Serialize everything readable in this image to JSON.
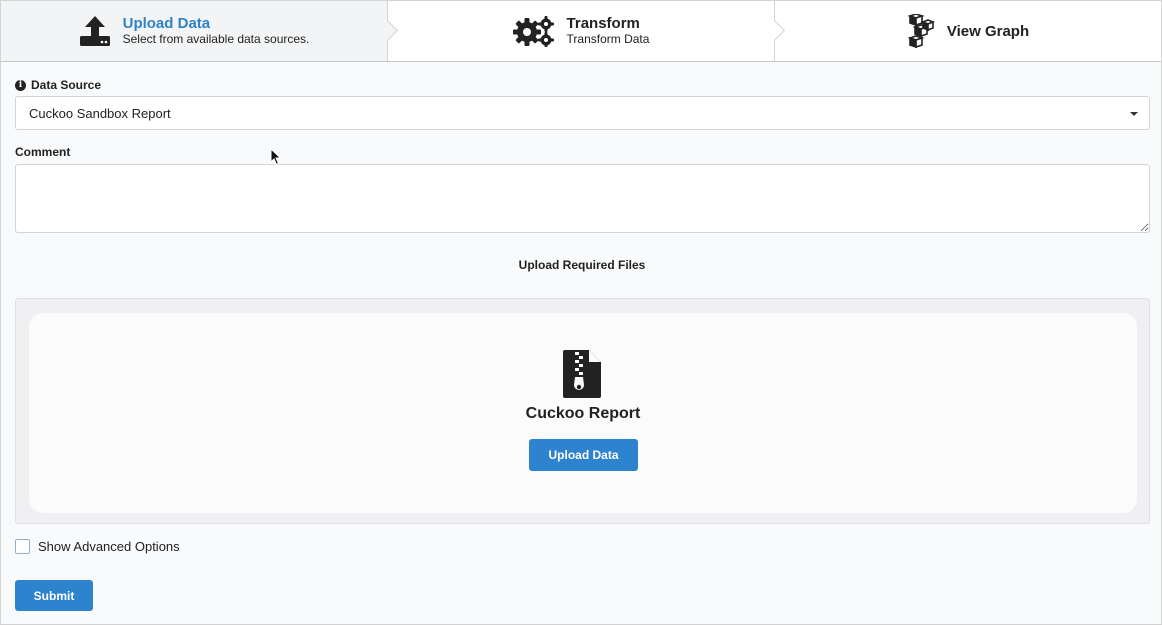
{
  "steps": [
    {
      "title": "Upload Data",
      "description": "Select from available data sources.",
      "icon": "upload-icon",
      "active": true
    },
    {
      "title": "Transform",
      "description": "Transform Data",
      "icon": "gears-icon",
      "active": false
    },
    {
      "title": "View Graph",
      "description": "",
      "icon": "cubes-icon",
      "active": false
    }
  ],
  "form": {
    "data_source_label": "Data Source",
    "data_source_value": "Cuckoo Sandbox Report",
    "comment_label": "Comment",
    "comment_value": "",
    "section_title": "Upload Required Files",
    "file_title": "Cuckoo Report",
    "upload_label": "Upload Data",
    "advanced_label": "Show Advanced Options",
    "submit_label": "Submit"
  },
  "colors": {
    "accent": "#2e83cf",
    "active_step_title": "#2e83c8"
  }
}
